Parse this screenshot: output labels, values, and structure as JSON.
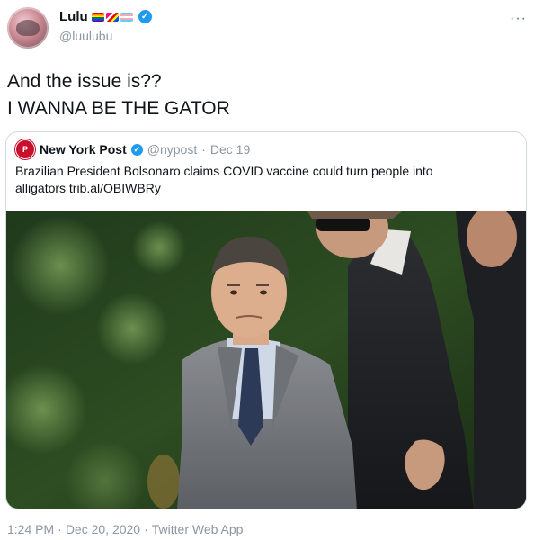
{
  "author": {
    "display_name": "Lulu",
    "handle": "@luulubu",
    "emoji_badges": [
      "rainbow-flag",
      "pride-flag",
      "trans-flag"
    ]
  },
  "tweet": {
    "text_line1": "And the issue is??",
    "text_line2": "I WANNA BE THE GATOR"
  },
  "quote": {
    "author_name": "New York Post",
    "avatar_letter": "P",
    "handle": "@nypost",
    "separator": "·",
    "date": "Dec 19",
    "text_line1": "Brazilian President Bolsonaro claims COVID vaccine could turn people into",
    "text_line2": "alligators trib.al/OBIWBRy"
  },
  "footer": {
    "time": "1:24 PM",
    "separator1": "·",
    "date": "Dec 20, 2020",
    "separator2": "·",
    "source": "Twitter Web App"
  },
  "menu": {
    "more_label": "···"
  },
  "colors": {
    "verified": "#1d9bf0",
    "muted_text": "#8a96a3",
    "nypost_red": "#c8102e",
    "border": "#cfd9de"
  },
  "icons": {
    "verified": "verified-badge-icon",
    "more": "more-horizontal-icon"
  }
}
